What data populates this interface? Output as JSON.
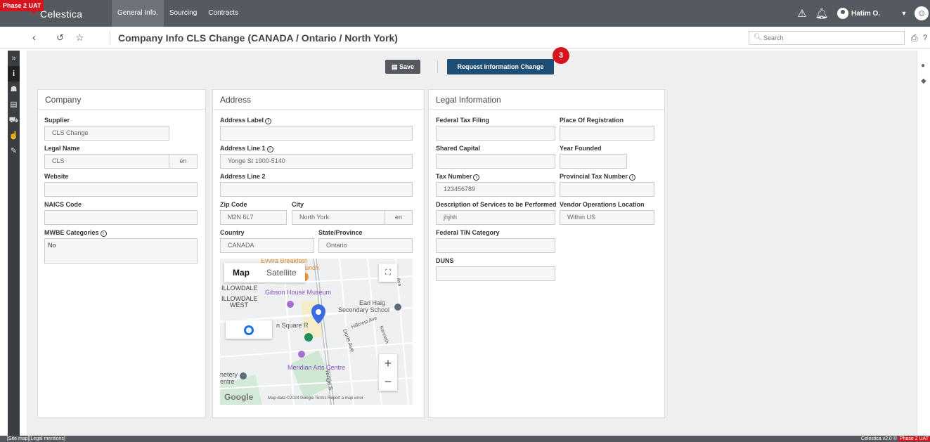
{
  "env_badge": "Phase 2 UAT",
  "brand": "Celestica",
  "nav": {
    "tabs": [
      "General Info.",
      "Sourcing",
      "Contracts"
    ],
    "active": "General Info."
  },
  "user": {
    "name": "Hatim O."
  },
  "page": {
    "title": "Company Info CLS Change (CANADA / Ontario / North York)"
  },
  "search": {
    "placeholder": "Search"
  },
  "actions": {
    "save": "Save",
    "request_change": "Request Information Change",
    "pending_count": "3"
  },
  "company": {
    "title": "Company",
    "supplier_label": "Supplier",
    "supplier": "CLS Change",
    "legal_name_label": "Legal Name",
    "legal_name": "CLS",
    "legal_name_lang": "en",
    "website_label": "Website",
    "website": "",
    "naics_label": "NAICS Code",
    "naics": "",
    "mwbe_label": "MWBE Categories",
    "mwbe": "No"
  },
  "address": {
    "title": "Address",
    "label_label": "Address Label",
    "label": "",
    "line1_label": "Address Line 1",
    "line1": "Yonge St 1900-5140",
    "line2_label": "Address Line 2",
    "line2": "",
    "zip_label": "Zip Code",
    "zip": "M2N 6L7",
    "city_label": "City",
    "city": "North York",
    "city_lang": "en",
    "country_label": "Country",
    "country": "CANADA",
    "state_label": "State/Province",
    "state": "Ontario",
    "map": {
      "type_map": "Map",
      "type_satellite": "Satellite",
      "labels": [
        "Eyvira Breakfast",
        "Lunch",
        "ILLOWDALE",
        "Gibson House Museum",
        "ILLOWDALE",
        "WEST",
        "Earl Haig",
        "Secondary School",
        "n Square R",
        "Hillcrest Ave",
        "Doris Ave",
        "Kenneth",
        "Meridian Arts Centre",
        "netery",
        "entre",
        "Yonge S",
        "Ave"
      ],
      "logo": "Google",
      "attribution": "Map data ©2024 Google   Terms   Report a map error"
    }
  },
  "legal": {
    "title": "Legal Information",
    "federal_tax_filing_label": "Federal Tax Filing",
    "federal_tax_filing": "",
    "place_of_registration_label": "Place Of Registration",
    "place_of_registration": "",
    "shared_capital_label": "Shared Capital",
    "shared_capital": "",
    "year_founded_label": "Year Founded",
    "year_founded": "",
    "tax_number_label": "Tax Number",
    "tax_number": "123456789",
    "provincial_tax_label": "Provincial Tax Number",
    "provincial_tax": "",
    "services_desc_label": "Description of Services to be Performed",
    "services_desc": "jhjhh",
    "vendor_ops_label": "Vendor Operations Location",
    "vendor_ops": "Within US",
    "federal_tin_label": "Federal TIN Category",
    "federal_tin": "",
    "duns_label": "DUNS",
    "duns": ""
  },
  "footer": {
    "left": "[Site map][Legal mentions]",
    "right": "Celestica v2.0 ©",
    "right_badge": "Phase 2 UAT"
  }
}
